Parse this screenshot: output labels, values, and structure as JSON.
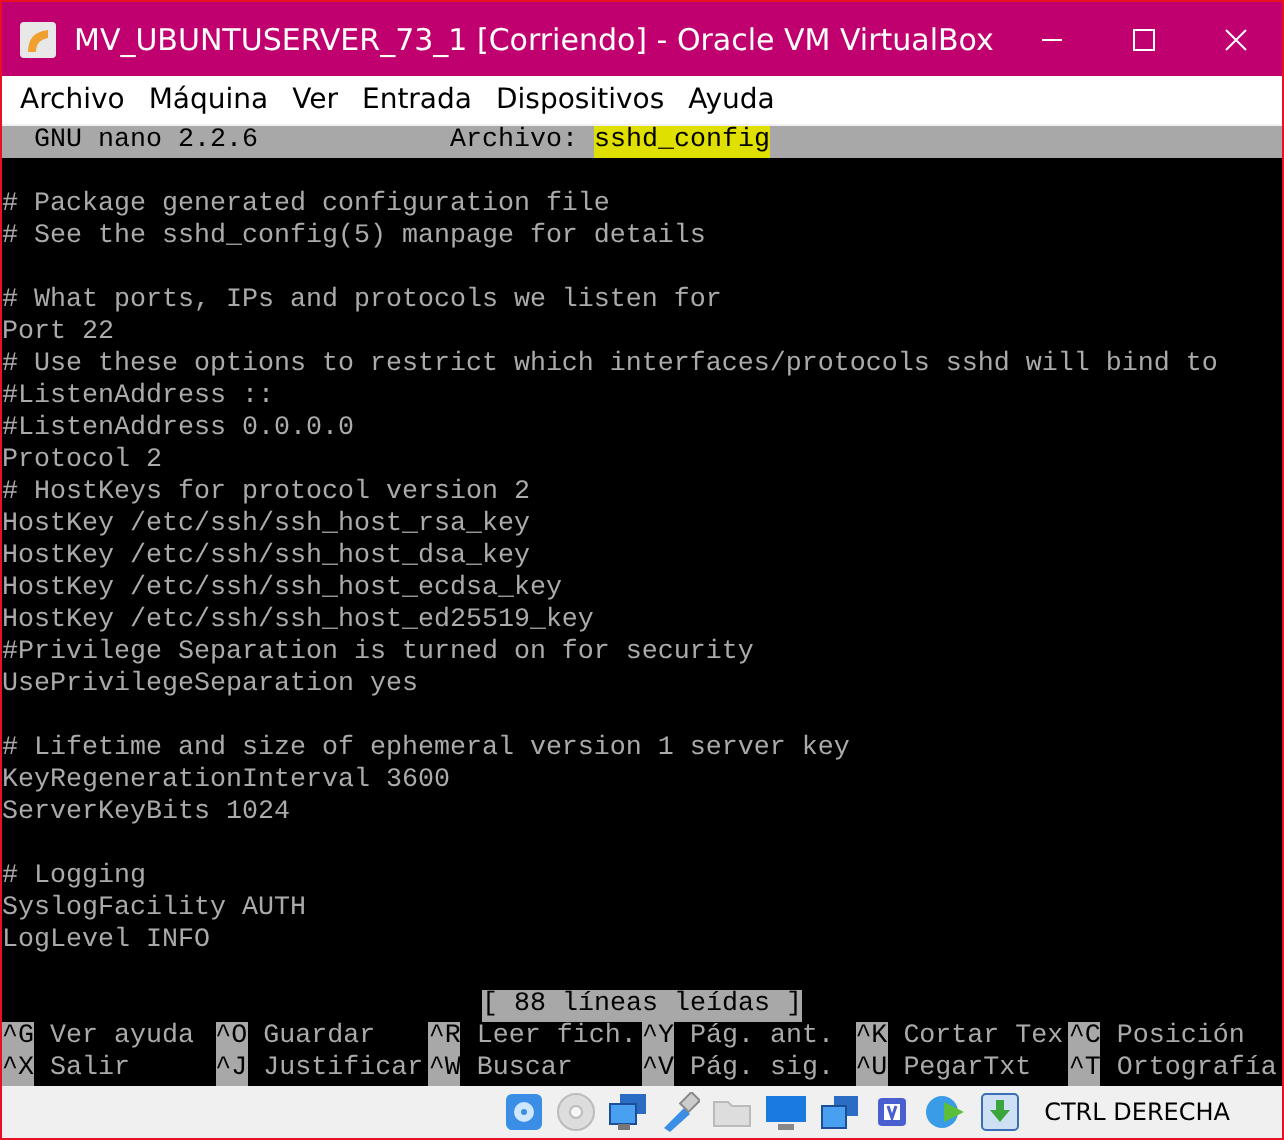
{
  "window": {
    "title": "MV_UBUNTUSERVER_73_1 [Corriendo] - Oracle VM VirtualBox"
  },
  "menu": [
    "Archivo",
    "Máquina",
    "Ver",
    "Entrada",
    "Dispositivos",
    "Ayuda"
  ],
  "nano_header": {
    "version": "GNU nano 2.2.6",
    "file_label": "Archivo:",
    "file_name": "sshd_config",
    "file_highlighted": true
  },
  "file_blocks": [
    [
      "# Package generated configuration file",
      "# See the sshd_config(5) manpage for details"
    ],
    [
      "# What ports, IPs and protocols we listen for",
      "Port 22",
      "# Use these options to restrict which interfaces/protocols sshd will bind to",
      "#ListenAddress ::",
      "#ListenAddress 0.0.0.0",
      "Protocol 2",
      "# HostKeys for protocol version 2",
      "HostKey /etc/ssh/ssh_host_rsa_key",
      "HostKey /etc/ssh/ssh_host_dsa_key",
      "HostKey /etc/ssh/ssh_host_ecdsa_key",
      "HostKey /etc/ssh/ssh_host_ed25519_key",
      "#Privilege Separation is turned on for security",
      "UsePrivilegeSeparation yes"
    ],
    [
      "# Lifetime and size of ephemeral version 1 server key",
      "KeyRegenerationInterval 3600",
      "ServerKeyBits 1024"
    ],
    [
      "# Logging",
      "SyslogFacility AUTH",
      "LogLevel INFO"
    ]
  ],
  "status_message": "[ 88 líneas leídas ]",
  "shortcuts": [
    [
      {
        "key": "^G",
        "label": "Ver ayuda"
      },
      {
        "key": "^O",
        "label": "Guardar"
      },
      {
        "key": "^R",
        "label": "Leer fich."
      },
      {
        "key": "^Y",
        "label": "Pág. ant."
      },
      {
        "key": "^K",
        "label": "Cortar Tex"
      },
      {
        "key": "^C",
        "label": "Posición"
      }
    ],
    [
      {
        "key": "^X",
        "label": "Salir"
      },
      {
        "key": "^J",
        "label": "Justificar"
      },
      {
        "key": "^W",
        "label": "Buscar"
      },
      {
        "key": "^V",
        "label": "Pág. sig."
      },
      {
        "key": "^U",
        "label": "PegarTxt"
      },
      {
        "key": "^T",
        "label": "Ortografía"
      }
    ]
  ],
  "status_bar": {
    "icons": [
      {
        "kind": "disk"
      },
      {
        "kind": "optical"
      },
      {
        "kind": "network"
      },
      {
        "kind": "usb"
      },
      {
        "kind": "folder"
      },
      {
        "kind": "display"
      },
      {
        "kind": "screens"
      },
      {
        "kind": "chip"
      },
      {
        "kind": "capture"
      },
      {
        "kind": "download"
      }
    ],
    "host_key": "CTRL DERECHA"
  }
}
